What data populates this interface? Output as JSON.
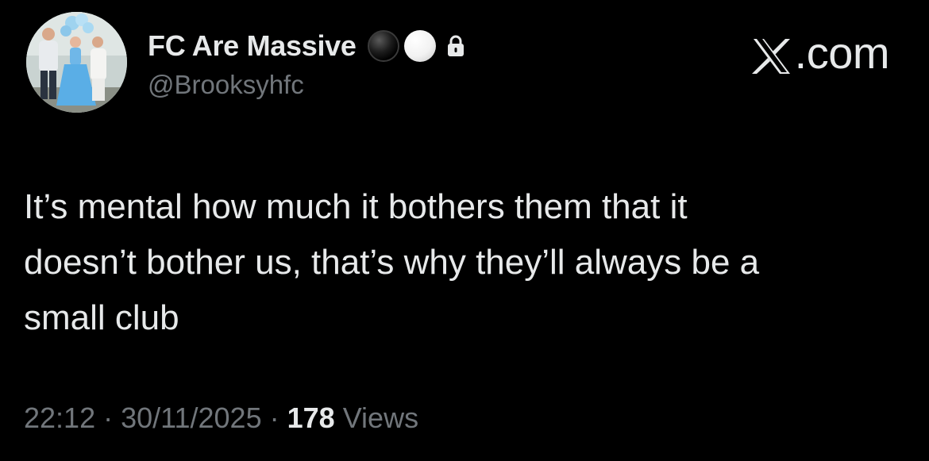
{
  "post": {
    "author": {
      "display_name": "FC Are Massive",
      "handle": "@Brooksyhfc",
      "name_emojis": [
        "black-circle-emoji",
        "white-circle-emoji"
      ],
      "protected_icon": "lock-icon",
      "avatar": "profile-photo"
    },
    "brand": {
      "icon": "x-logo-icon",
      "text": ".com"
    },
    "text_lines": [
      "It’s mental how much it bothers them that it",
      "doesn’t bother us, that’s why they’ll always be a",
      "small club"
    ],
    "meta": {
      "time": "22:12",
      "separator": "·",
      "date": "30/11/2025",
      "views_count": "178",
      "views_label": "Views"
    }
  },
  "colors": {
    "background": "#000000",
    "primary_text": "#e7e9ea",
    "secondary_text": "#71767b"
  }
}
